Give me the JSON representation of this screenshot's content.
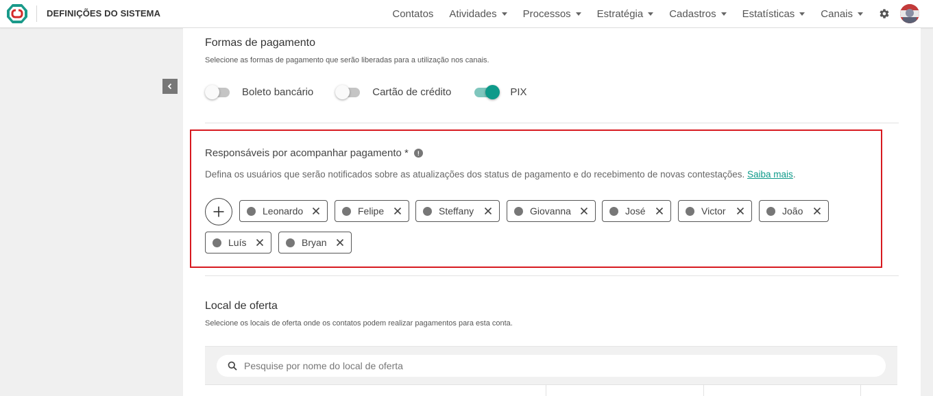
{
  "header": {
    "app_title": "DEFINIÇÕES DO SISTEMA",
    "nav": [
      {
        "label": "Contatos",
        "has_dropdown": false
      },
      {
        "label": "Atividades",
        "has_dropdown": true
      },
      {
        "label": "Processos",
        "has_dropdown": true
      },
      {
        "label": "Estratégia",
        "has_dropdown": true
      },
      {
        "label": "Cadastros",
        "has_dropdown": true
      },
      {
        "label": "Estatísticas",
        "has_dropdown": true
      },
      {
        "label": "Canais",
        "has_dropdown": true
      }
    ],
    "icons": {
      "settings": "gear-icon",
      "avatar": "user-avatar",
      "logo": "app-logo-icon"
    }
  },
  "payment_methods": {
    "title": "Formas de pagamento",
    "description": "Selecione as formas de pagamento que serão liberadas para a utilização nos canais.",
    "options": [
      {
        "label": "Boleto bancário",
        "enabled": false
      },
      {
        "label": "Cartão de crédito",
        "enabled": false
      },
      {
        "label": "PIX",
        "enabled": true
      }
    ]
  },
  "responsibles": {
    "title": "Responsáveis por acompanhar pagamento *",
    "info_icon": "!",
    "description": "Defina os usuários que serão notificados sobre as atualizações dos status de pagamento e do recebimento de novas contestações.",
    "link_text": "Saiba mais",
    "trailing": ".",
    "users": [
      "Leonardo",
      "Felipe",
      "Steffany",
      "Giovanna",
      "José",
      "Victor",
      "João",
      "Luís",
      "Bryan"
    ]
  },
  "offer_location": {
    "title": "Local de oferta",
    "description": "Selecione os locais de oferta onde os contatos podem realizar pagamentos para esta conta.",
    "search_placeholder": "Pesquise por nome do local de oferta"
  },
  "colors": {
    "accent": "#0e9a8a",
    "highlight_border": "#d7191f",
    "logo": "#1a9a8a"
  }
}
